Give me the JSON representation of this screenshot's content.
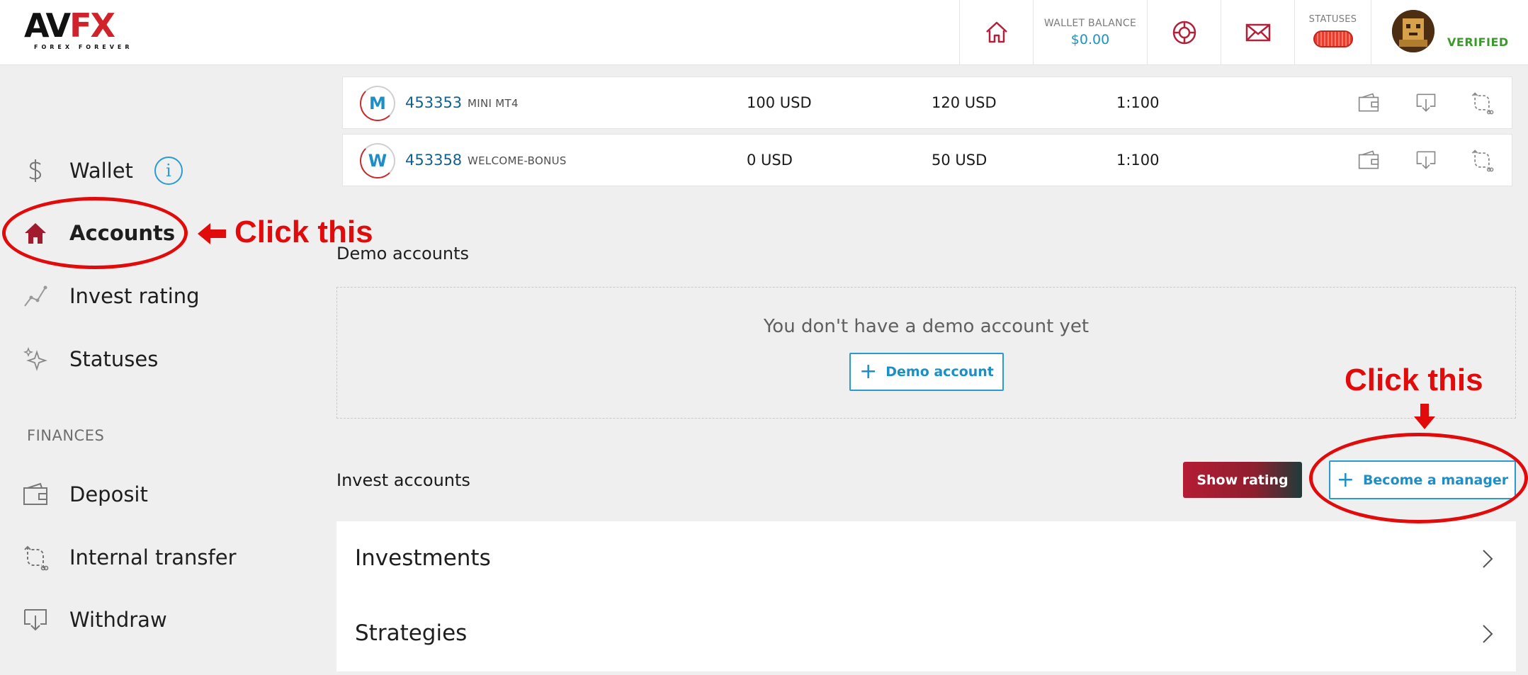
{
  "header": {
    "logo_text_a": "AV",
    "logo_text_b": "FX",
    "logo_tagline": "FOREX FOREVER",
    "wallet_balance_label": "WALLET BALANCE",
    "wallet_balance_value": "$0.00",
    "statuses_label": "STATUSES",
    "verified_label": "VERIFIED",
    "icons": [
      "home-icon",
      "lifebuoy-icon",
      "mail-icon"
    ]
  },
  "sidebar": {
    "items": [
      {
        "label": "Wallet",
        "icon": "dollar-icon"
      },
      {
        "label": "Accounts",
        "icon": "house-icon",
        "active": true
      },
      {
        "label": "Invest rating",
        "icon": "chart-line-icon"
      },
      {
        "label": "Statuses",
        "icon": "sparkle-icon"
      }
    ],
    "finances_label": "FINANCES",
    "finance_items": [
      {
        "label": "Deposit",
        "icon": "wallet-icon"
      },
      {
        "label": "Internal transfer",
        "icon": "transfer-icon"
      },
      {
        "label": "Withdraw",
        "icon": "withdraw-icon"
      }
    ],
    "wallet_info": "i"
  },
  "accounts": [
    {
      "letter": "M",
      "number": "453353",
      "type": "MINI MT4",
      "col1": "100 USD",
      "col2": "120 USD",
      "leverage": "1:100"
    },
    {
      "letter": "W",
      "number": "453358",
      "type": "WELCOME-BONUS",
      "col1": "0 USD",
      "col2": "50 USD",
      "leverage": "1:100"
    }
  ],
  "demo": {
    "title": "Demo accounts",
    "empty_message": "You don't have a demo account yet",
    "button_plus": "+",
    "button_label": "Demo account"
  },
  "invest": {
    "title": "Invest accounts",
    "show_rating_label": "Show rating",
    "become_manager_plus": "+",
    "become_manager_label": "Become a manager",
    "rows": [
      {
        "label": "Investments"
      },
      {
        "label": "Strategies"
      }
    ]
  },
  "annotations": {
    "left_text": "Click this",
    "right_text": "Click this",
    "color": "#e20b0b"
  },
  "colors": {
    "accent_blue": "#1e8fc6",
    "brand_red": "#d0222a",
    "verified_green": "#3b9a2b"
  }
}
